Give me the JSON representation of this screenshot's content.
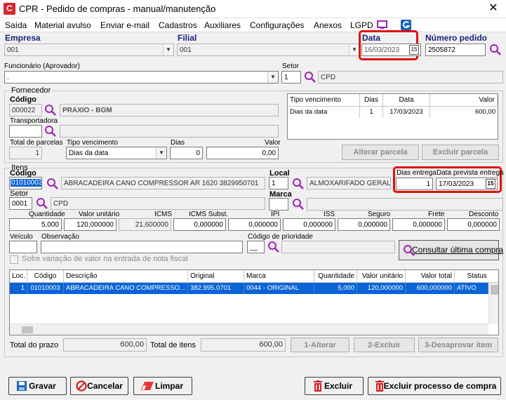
{
  "window": {
    "title": "CPR - Pedido de compras - manual/manutenção",
    "icon_letter": "C",
    "close_glyph": "✕"
  },
  "menu": [
    "Saída",
    "Material avulso",
    "Enviar e-mail",
    "Cadastros",
    "Auxiliares",
    "Configurações",
    "Anexos",
    "LGPD"
  ],
  "header": {
    "empresa_label": "Empresa",
    "empresa_value": "001",
    "filial_label": "Filial",
    "filial_value": "001",
    "data_label": "Data",
    "data_value": "16/03/2023",
    "data_cal": "15",
    "numero_label": "Número pedido",
    "numero_value": "2505872",
    "funcionario_label": "Funcionário (Aprovador)",
    "funcionario_value": ".",
    "setor_label": "Setor",
    "setor_code": "1",
    "setor_name": "CPD"
  },
  "fornecedor": {
    "group": "Fornecedor",
    "codigo_label": "Código",
    "codigo_value": "000022",
    "nome_value": "PRAXIO - BGM",
    "transportadora_label": "Transportadora",
    "total_parcelas_label": "Total de parcelas",
    "total_parcelas_value": "1",
    "tipo_venc_label": "Tipo vencimento",
    "tipo_venc_value": "Dias da data",
    "dias_label": "Dias",
    "dias_value": "0",
    "valor_label": "Valor",
    "valor_value": "0,00",
    "table": {
      "headers": [
        "Tipo vencimento",
        "Dias",
        "Data",
        "Valor"
      ],
      "rows": [
        [
          "Dias da data",
          "1",
          "17/03/2023",
          "600,00"
        ]
      ]
    },
    "alterar_parcela": "Alterar parcela",
    "excluir_parcela": "Excluir parcela"
  },
  "itens": {
    "group": "Itens",
    "codigo_label": "Código",
    "codigo_value": "01010003",
    "descricao_value": "ABRACADEIRA CANO COMPRESSOR AR 1620 3829950701",
    "local_label": "Local",
    "local_code": "1",
    "local_name": "ALMOXARIFADO GERAL V",
    "dias_entrega_label": "Dias entrega",
    "dias_entrega_value": "1",
    "data_prevista_label": "Data prevista entrega",
    "data_prevista_value": "17/03/2023",
    "data_cal": "15",
    "setor_label": "Setor",
    "setor_code": "0001",
    "setor_name": "CPD",
    "marca_label": "Marca",
    "quantidade_label": "Quantidade",
    "quantidade_value": "5,000",
    "valor_unit_label": "Valor unitário",
    "valor_unit_value": "120,000000",
    "icms_label": "ICMS",
    "icms_value": "21,600000",
    "icms_subst_label": "ICMS Subst.",
    "icms_subst_value": "0,000000",
    "ipi_label": "IPI",
    "ipi_value": "0,000000",
    "iss_label": "ISS",
    "iss_value": "0,000000",
    "seguro_label": "Seguro",
    "seguro_value": "0,000000",
    "frete_label": "Frete",
    "frete_value": "0,000000",
    "desconto_label": "Desconto",
    "desconto_value": "0,000000",
    "veiculo_label": "Veículo",
    "observacao_label": "Observação",
    "prioridade_label": "Código de prioridade",
    "prioridade_value": "__",
    "consultar_label": "Consultar última compra",
    "sofre_variacao_label": "Sofre variação de valor na entrada de nota fiscal",
    "table": {
      "headers": [
        "Loc.",
        "Código",
        "Descrição",
        "Original",
        "Marca",
        "Quantidade",
        "Valor unitário",
        "Valor total",
        "Status"
      ],
      "rows": [
        [
          "1",
          "01010003",
          "ABRACADEIRA CANO COMPRESSO...",
          "382.995.0701",
          "0044 - ORIGINAL",
          "5,000",
          "120,000000",
          "600,000000",
          "ATIVO"
        ]
      ]
    }
  },
  "totals": {
    "total_prazo_label": "Total do prazo",
    "total_prazo_value": "600,00",
    "total_itens_label": "Total de itens",
    "total_itens_value": "600,00",
    "alterar": "1-Alterar",
    "excluir": "2-Excluir",
    "desaprovar": "3-Desaprovar item"
  },
  "footer": {
    "gravar": "Gravar",
    "cancelar": "Cancelar",
    "limpar": "Limpar",
    "excluir": "Excluir",
    "excluir_processo": "Excluir processo de compra"
  }
}
